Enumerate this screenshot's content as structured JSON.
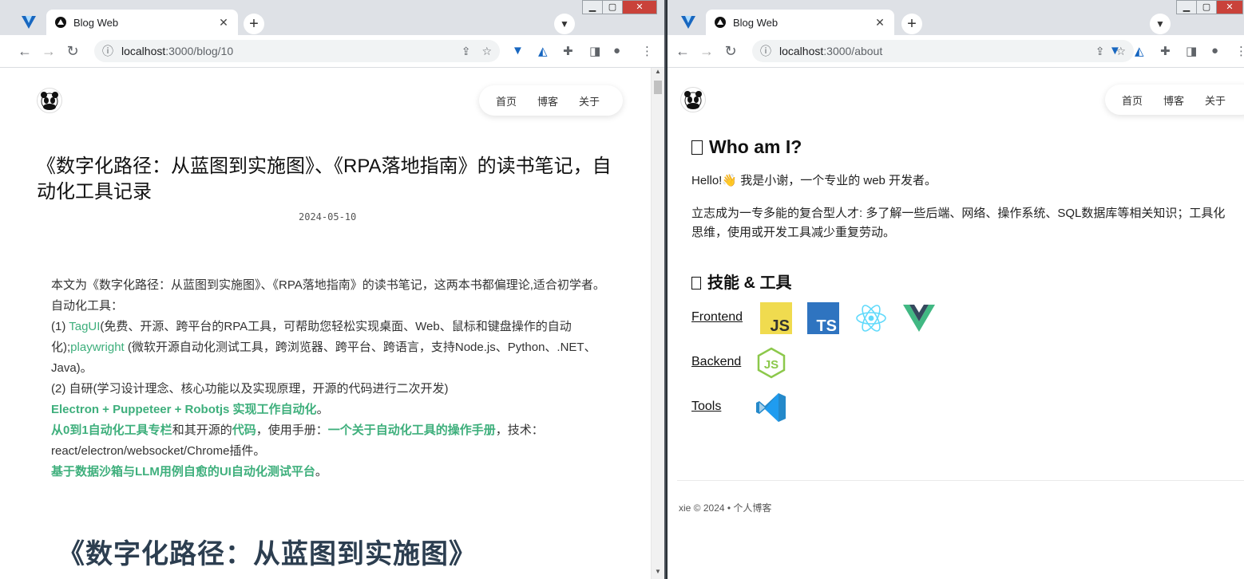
{
  "left": {
    "tab_title": "Blog Web",
    "url_host": "localhost",
    "url_path": ":3000/blog/10",
    "nav": [
      "首页",
      "博客",
      "关于"
    ],
    "post": {
      "title": "《数字化路径：从蓝图到实施图》、《RPA落地指南》的读书笔记，自动化工具记录",
      "date": "2024-05-10",
      "p1": "本文为《数字化路径：从蓝图到实施图》、《RPA落地指南》的读书笔记，这两本书都偏理论,适合初学者。",
      "p2": "自动化工具：",
      "p3_prefix": "(1) ",
      "p3_link1": "TagUI",
      "p3_mid": "(免费、开源、跨平台的RPA工具，可帮助您轻松实现桌面、Web、鼠标和键盘操作的自动化);",
      "p3_link2": "playwright",
      "p3_suffix": " (微软开源自动化测试工具，跨浏览器、跨平台、跨语言，支持Node.js、Python、.NET、Java)。",
      "p4": "(2) 自研(学习设计理念、核心功能以及实现原理，开源的代码进行二次开发)",
      "p5_link": "Electron + Puppeteer + Robotjs 实现工作自动化",
      "p5_end": "。",
      "p6_link1": "从0到1自动化工具专栏",
      "p6_mid1": "和其开源的",
      "p6_link2": "代码",
      "p6_mid2": "，使用手册：",
      "p6_link3": "一个关于自动化工具的操作手册",
      "p6_end": "，技术：react/electron/websocket/Chrome插件。",
      "p7_link": "基于数据沙箱与LLM用例自愈的UI自动化测试平台",
      "p7_end": "。",
      "heading": "《数字化路径：从蓝图到实施图》"
    }
  },
  "right": {
    "tab_title": "Blog Web",
    "url_host": "localhost",
    "url_path": ":3000/about",
    "nav": [
      "首页",
      "博客",
      "关于"
    ],
    "who_title": "Who am I?",
    "hello": "Hello!👋 我是小谢，一个专业的 web 开发者。",
    "aspiration": "立志成为一专多能的复合型人才: 多了解一些后端、网络、操作系统、SQL数据库等相关知识；工具化思维，使用或开发工具减少重复劳动。",
    "skills_title": "技能 & 工具",
    "skills": [
      {
        "label": "Frontend",
        "icons": [
          "javascript-icon",
          "typescript-icon",
          "react-icon",
          "vue-icon"
        ]
      },
      {
        "label": "Backend",
        "icons": [
          "nodejs-icon"
        ]
      },
      {
        "label": "Tools",
        "icons": [
          "vscode-icon"
        ]
      }
    ],
    "logo_text": {
      "js": "JS",
      "ts": "TS"
    },
    "footer": "xie © 2024  •  个人博客"
  },
  "colors": {
    "accent": "#3eaf7c",
    "heading": "#2c3e50"
  }
}
